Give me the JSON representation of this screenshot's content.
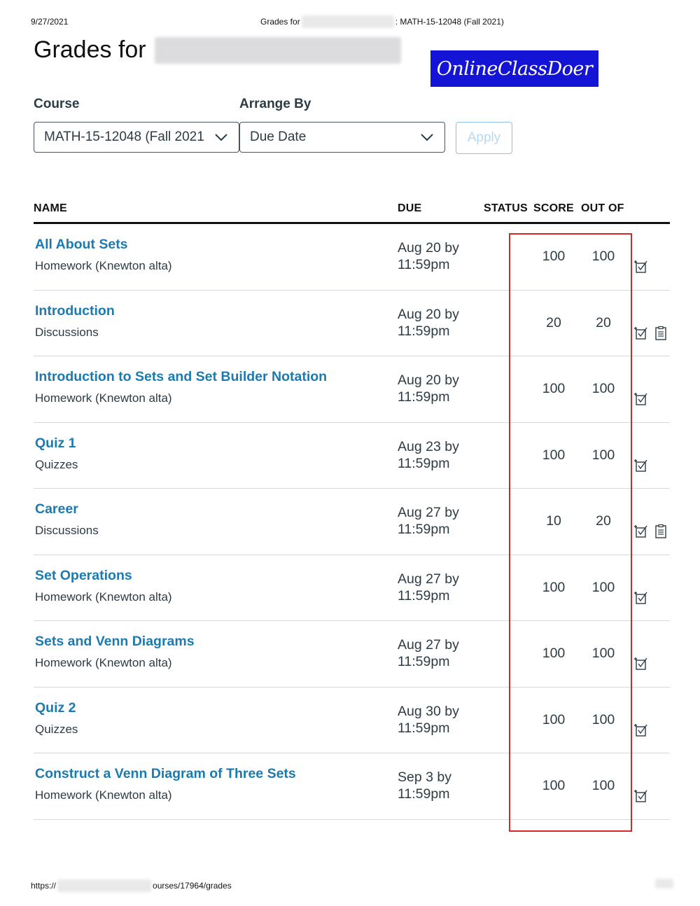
{
  "print_header": {
    "date": "9/27/2021",
    "title_prefix": "Grades for",
    "title_suffix": ": MATH-15-12048 (Fall 2021)"
  },
  "page": {
    "title": "Grades for",
    "logo_text": "OnlineClassDoer"
  },
  "filters": {
    "course_label": "Course",
    "course_value": "MATH-15-12048 (Fall 2021",
    "arrange_label": "Arrange By",
    "arrange_value": "Due Date",
    "apply_label": "Apply"
  },
  "table": {
    "columns": [
      "NAME",
      "DUE",
      "STATUS",
      "SCORE",
      "OUT OF"
    ],
    "rows": [
      {
        "name": "All About Sets",
        "category": "Homework (Knewton alta)",
        "due_date": "Aug 20 by",
        "due_time": "11:59pm",
        "score": "100",
        "out_of": "100",
        "icons": [
          "submission-icon"
        ]
      },
      {
        "name": "Introduction",
        "category": "Discussions",
        "due_date": "Aug 20 by",
        "due_time": "11:59pm",
        "score": "20",
        "out_of": "20",
        "icons": [
          "submission-icon",
          "rubric-icon"
        ]
      },
      {
        "name": "Introduction to Sets and Set Builder Notation",
        "category": "Homework (Knewton alta)",
        "due_date": "Aug 20 by",
        "due_time": "11:59pm",
        "score": "100",
        "out_of": "100",
        "icons": [
          "submission-icon"
        ]
      },
      {
        "name": "Quiz 1",
        "category": "Quizzes",
        "due_date": "Aug 23 by",
        "due_time": "11:59pm",
        "score": "100",
        "out_of": "100",
        "icons": [
          "submission-icon"
        ]
      },
      {
        "name": "Career",
        "category": "Discussions",
        "due_date": "Aug 27 by",
        "due_time": "11:59pm",
        "score": "10",
        "out_of": "20",
        "icons": [
          "submission-icon",
          "rubric-icon"
        ]
      },
      {
        "name": "Set Operations",
        "category": "Homework (Knewton alta)",
        "due_date": "Aug 27 by",
        "due_time": "11:59pm",
        "score": "100",
        "out_of": "100",
        "icons": [
          "submission-icon"
        ]
      },
      {
        "name": "Sets and Venn Diagrams",
        "category": "Homework (Knewton alta)",
        "due_date": "Aug 27 by",
        "due_time": "11:59pm",
        "score": "100",
        "out_of": "100",
        "icons": [
          "submission-icon"
        ]
      },
      {
        "name": "Quiz 2",
        "category": "Quizzes",
        "due_date": "Aug 30 by",
        "due_time": "11:59pm",
        "score": "100",
        "out_of": "100",
        "icons": [
          "submission-icon"
        ]
      },
      {
        "name": "Construct a Venn Diagram of Three Sets",
        "category": "Homework (Knewton alta)",
        "due_date": "Sep 3 by",
        "due_time": "11:59pm",
        "score": "100",
        "out_of": "100",
        "icons": [
          "submission-icon"
        ]
      }
    ]
  },
  "footer": {
    "url_prefix": "https://",
    "url_suffix": "ourses/17964/grades"
  },
  "colors": {
    "link": "#1b7bb0",
    "text": "#2d3b45",
    "highlight": "#d62828",
    "logo_bg": "#1414d6"
  }
}
